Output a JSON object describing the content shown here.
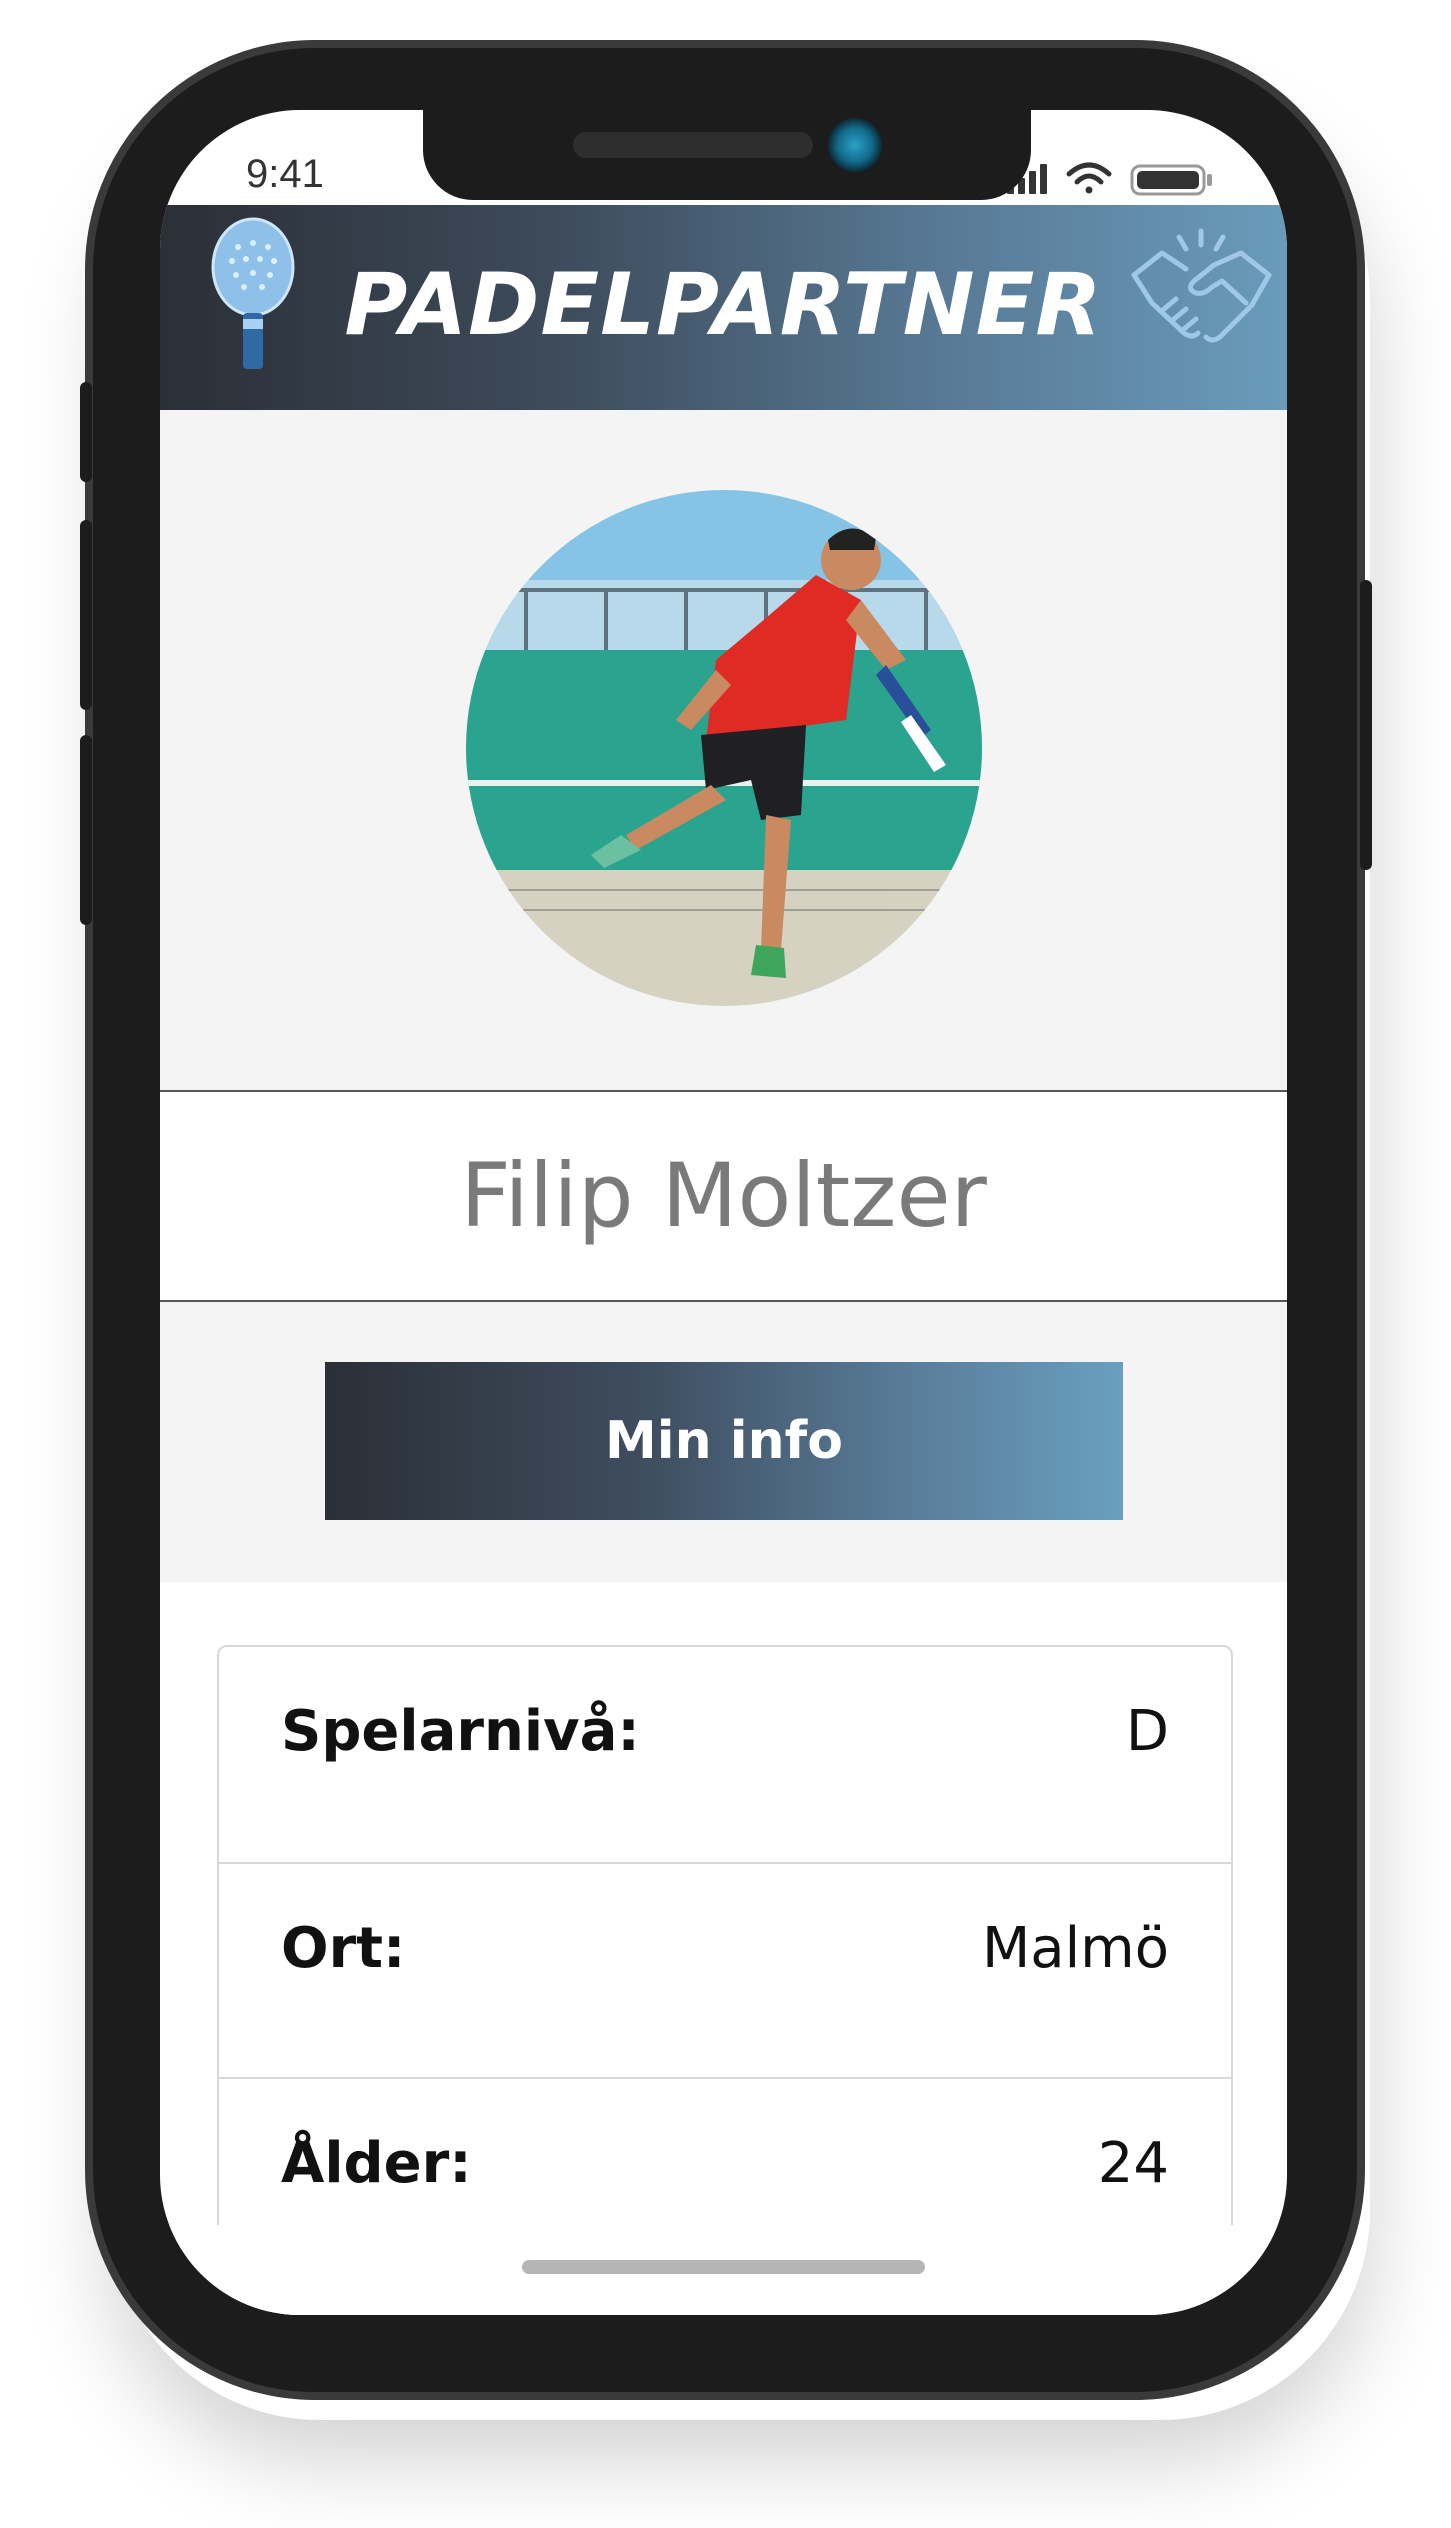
{
  "status_bar": {
    "time": "9:41",
    "icons": [
      "signal-icon",
      "wifi-icon",
      "battery-icon"
    ]
  },
  "header": {
    "title": "PADELPARTNER",
    "left_icon": "padel-racket-icon",
    "right_icon": "handshake-icon",
    "gradient": [
      "#2b2f36",
      "#6a9bbb"
    ]
  },
  "profile": {
    "photo": "profile-photo",
    "name": "Filip Moltzer"
  },
  "info_button": {
    "label": "Min info"
  },
  "details": [
    {
      "label": "Spelarnivå:",
      "value": "D"
    },
    {
      "label": "Ort:",
      "value": "Malmö"
    },
    {
      "label": "Ålder:",
      "value": "24"
    }
  ],
  "colors": {
    "accent": "#6a9bbb",
    "dark": "#2b2f36",
    "background": "#f4f4f4",
    "name_text": "#7a7a7a"
  }
}
